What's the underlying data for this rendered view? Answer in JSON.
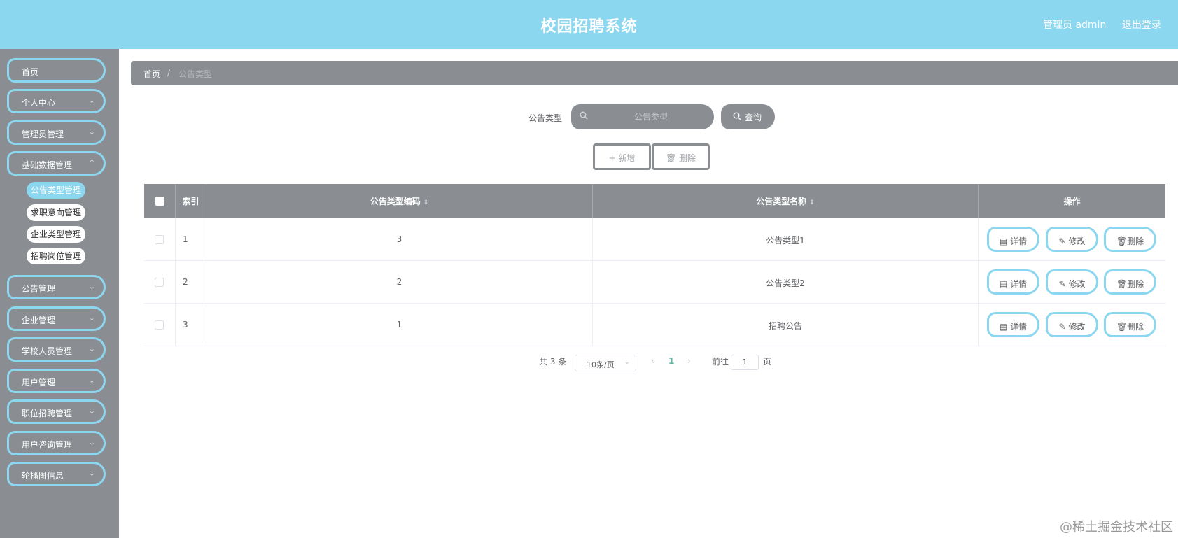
{
  "header": {
    "title": "校园招聘系统",
    "admin_label": "管理员 admin",
    "logout_label": "退出登录"
  },
  "sidebar": {
    "items": [
      {
        "label": "首页",
        "arrow": ""
      },
      {
        "label": "个人中心",
        "arrow": "⌄"
      },
      {
        "label": "管理员管理",
        "arrow": "⌄"
      },
      {
        "label": "基础数据管理",
        "arrow": "⌃"
      },
      {
        "label": "公告管理",
        "arrow": "⌄"
      },
      {
        "label": "企业管理",
        "arrow": "⌄"
      },
      {
        "label": "学校人员管理",
        "arrow": "⌄"
      },
      {
        "label": "用户管理",
        "arrow": "⌄"
      },
      {
        "label": "职位招聘管理",
        "arrow": "⌄"
      },
      {
        "label": "用户咨询管理",
        "arrow": "⌄"
      },
      {
        "label": "轮播图信息",
        "arrow": "⌄"
      }
    ],
    "sub_items": [
      "公告类型管理",
      "求职意向管理",
      "企业类型管理",
      "招聘岗位管理"
    ]
  },
  "breadcrumb": {
    "home": "首页",
    "separator": "/",
    "current": "公告类型"
  },
  "search": {
    "label": "公告类型",
    "placeholder": "公告类型",
    "value": "",
    "button_label": "查询"
  },
  "actions": {
    "add_label": "+ 新增",
    "delete_label": "删除"
  },
  "table": {
    "headers": [
      "索引",
      "公告类型编码",
      "公告类型名称",
      "操作"
    ],
    "sort_glyph": "⇕",
    "rows": [
      {
        "index": "1",
        "code": "3",
        "name": "公告类型1"
      },
      {
        "index": "2",
        "code": "2",
        "name": "公告类型2"
      },
      {
        "index": "3",
        "code": "1",
        "name": "招聘公告"
      }
    ],
    "row_actions": {
      "detail": "详情",
      "edit": "修改",
      "delete": "删除"
    }
  },
  "pagination": {
    "total_label": "共 3 条",
    "page_size": "10条/页",
    "current_page": "1",
    "goto_label": "前往",
    "goto_value": "1",
    "page_suffix": "页"
  },
  "watermark": "@稀土掘金技术社区",
  "colors": {
    "header": "#8cd7f0",
    "sidebar": "#8a8e93",
    "accent": "#8cd7f0",
    "page_active": "#5fb8a0"
  }
}
